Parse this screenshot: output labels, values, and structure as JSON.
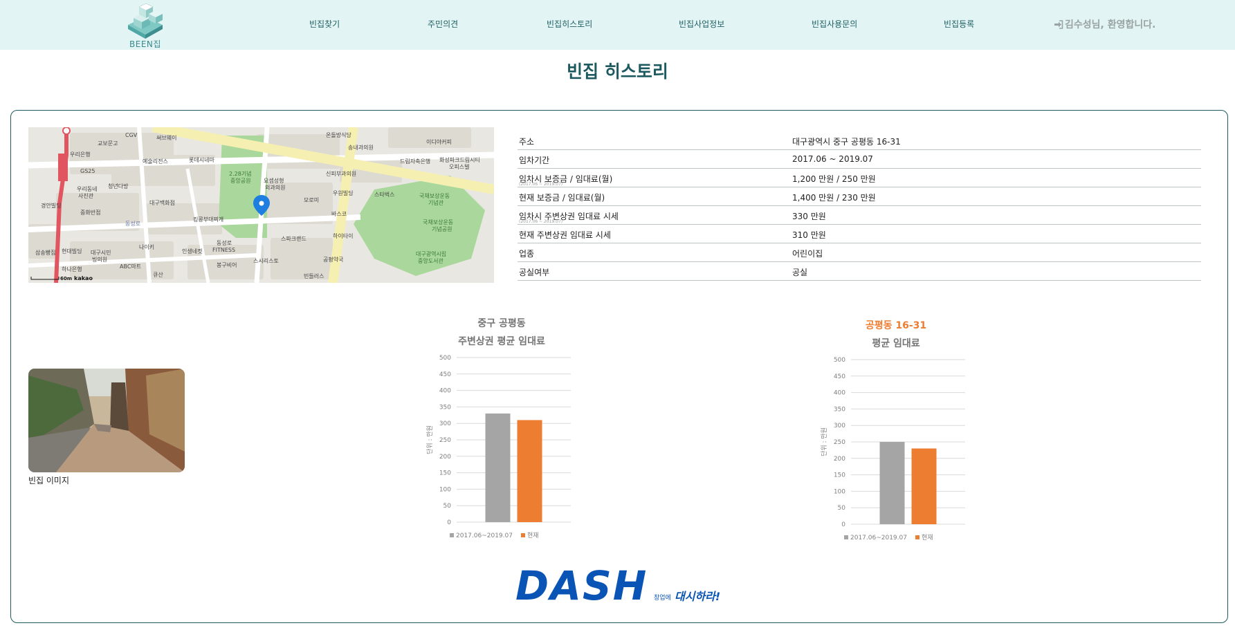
{
  "header": {
    "logo_text": "BEEN집",
    "nav": [
      "빈집찾기",
      "주민의견",
      "빈집히스토리",
      "빈집사업정보",
      "빈집사용문의",
      "빈집등록"
    ],
    "welcome": "김수성님, 환영합니다."
  },
  "page_title": "빈집 히스토리",
  "map": {
    "labels": [
      "CGV",
      "써브웨이",
      "온돌방식당",
      "이디야커피",
      "우리은행",
      "교보문고",
      "송내과의원",
      "GS25",
      "예술리전스",
      "롯데시네마",
      "2.28기념 중앙공원",
      "요셉성형외과의원",
      "신피부과의원",
      "드림자축은행",
      "화성파크드림시티 오피스텔",
      "GS25",
      "우리동네 서진관",
      "청년다방",
      "대구백화점",
      "우원빌딩",
      "스타벅스",
      "국채보상운동 기념관",
      "경안빌딩",
      "중화반점",
      "동성로",
      "킹콩부대찌개",
      "모로미",
      "바스코",
      "국채보상운동 기념공원",
      "나이키",
      "동성로 FITNESS",
      "스파크랜드",
      "하이타이",
      "대구광역시립 중앙도서관",
      "삼송빵집",
      "현대빌딩",
      "대구시민 빙의원",
      "인생네컷",
      "봉구비어",
      "스시리스토",
      "공평약국",
      "ABC마트",
      "하나은행",
      "빈들러스",
      "큐산"
    ],
    "scale_label": "60m",
    "brand": "kakao"
  },
  "info": [
    {
      "label": "주소",
      "value": "대구광역시 중구 공평동 16-31"
    },
    {
      "label": "임차기간",
      "value": "2017.06 ~ 2019.07"
    },
    {
      "label": "임차시 보증금 / 임대료(월)",
      "sub": "(2017.06 ~ 2019.07)",
      "value": "1,200 만원 / 250 만원"
    },
    {
      "label": "현재 보증금 / 임대료(월)",
      "value": "1,400 만원 / 230 만원"
    },
    {
      "label": "임차시 주변상권 임대료 시세",
      "sub": "(2017.06 ~ 2019.07)",
      "value": "330 만원"
    },
    {
      "label": "현재 주변상권 임대료 시세",
      "value": "310 만원"
    },
    {
      "label": "업종",
      "value": "어린이집"
    },
    {
      "label": "공실여부",
      "value": "공실"
    }
  ],
  "photo_caption": "빈집 이미지",
  "colors": {
    "primary": "#1d5a60",
    "header_bg": "#e2f5f4",
    "past_bar": "#a5a5a5",
    "current_bar": "#ed7d31",
    "dash_blue": "#0a54b6"
  },
  "chart_data": [
    {
      "type": "bar",
      "title_lines": [
        "중구 공평동",
        "주변상권 평균 임대료"
      ],
      "ylabel": "단위 : 만원",
      "categories": [
        "2017.06~2019.07",
        "현재"
      ],
      "values": [
        330,
        310
      ],
      "ylim": [
        0,
        500
      ],
      "yticks": [
        "0",
        "50",
        "100",
        "150",
        "200",
        "250",
        "300",
        "350",
        "400",
        "450",
        "500"
      ],
      "grid": true,
      "legend": [
        "2017.06~2019.07",
        "현재"
      ],
      "legend_position": "bottom"
    },
    {
      "type": "bar",
      "title_lines": [
        "공평동 16-31",
        "평균 임대료"
      ],
      "ylabel": "단위 : 만원",
      "categories": [
        "2017.06~2019.07",
        "현재"
      ],
      "values": [
        250,
        230
      ],
      "ylim": [
        0,
        500
      ],
      "yticks": [
        "0",
        "50",
        "100",
        "150",
        "200",
        "250",
        "300",
        "350",
        "400",
        "450",
        "500"
      ],
      "grid": true,
      "legend": [
        "2017.06~2019.07",
        "현재"
      ],
      "legend_position": "bottom"
    }
  ],
  "footer_logo": {
    "text": "DASH",
    "slogan_small": "창업에",
    "slogan_large": "대시하라!"
  }
}
